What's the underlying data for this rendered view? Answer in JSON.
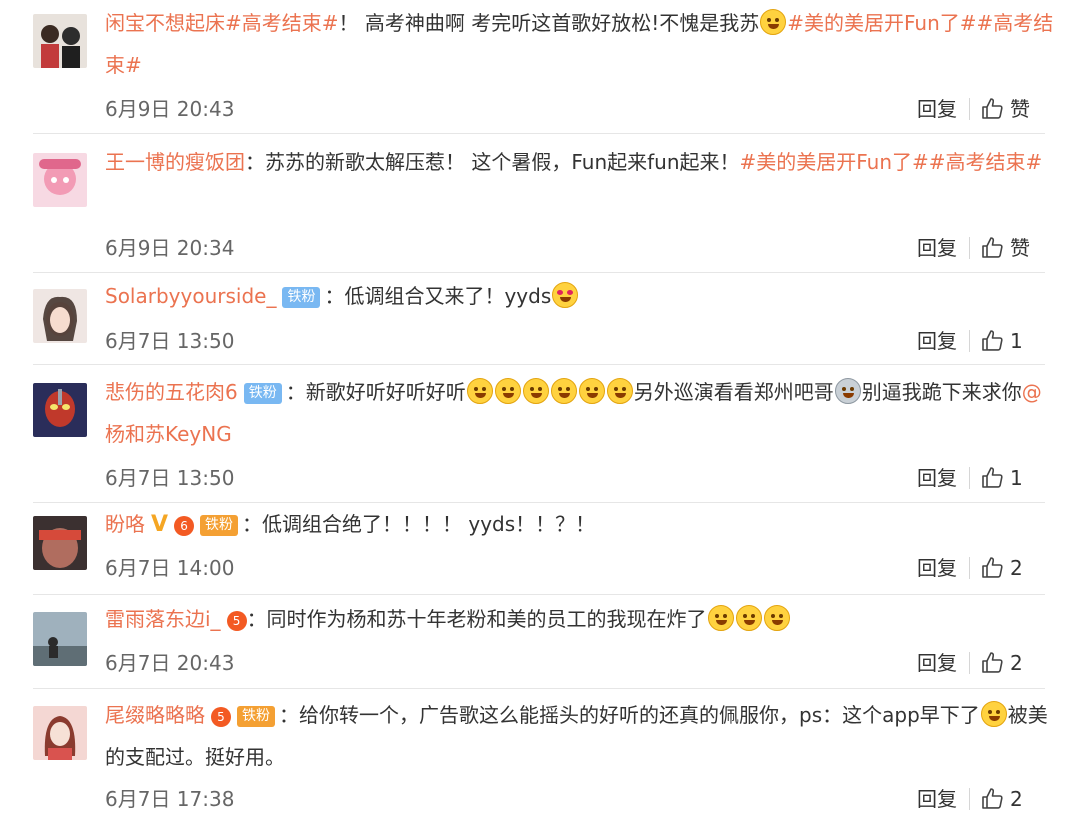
{
  "comments": [
    {
      "username": "闲宝不想起床",
      "text_a": "#高考结束#",
      "text_b": "！ 高考神曲啊 考完听这首歌好放松!不愧是我苏",
      "text_c": "#美的美居开Fun了##高考结束#",
      "time": "6月9日 20:43",
      "reply": "回复",
      "like": "赞"
    },
    {
      "username": "王一博的瘦饭团",
      "text_a": "：苏苏的新歌太解压惹！ 这个暑假，Fun起来fun起来！",
      "text_b": "#美的美居开Fun了##高考结束#",
      "time": "6月9日 20:34",
      "reply": "回复",
      "like": "赞"
    },
    {
      "username": "Solarbyyourside_",
      "badge": "铁粉",
      "text_a": "：低调组合又来了！yyds",
      "time": "6月7日 13:50",
      "reply": "回复",
      "like": "1"
    },
    {
      "username": "悲伤的五花肉6",
      "badge": "铁粉",
      "text_a": "：新歌好听好听好听",
      "text_b": "另外巡演看看郑州吧哥",
      "text_c": "别逼我跪下来求你",
      "mention": "@杨和苏KeyNG",
      "time": "6月7日 13:50",
      "reply": "回复",
      "like": "1"
    },
    {
      "username": "盼咯",
      "badge": "铁粉",
      "crown": "6",
      "text_a": "：低调组合绝了！！！！ yyds！！？！",
      "time": "6月7日 14:00",
      "reply": "回复",
      "like": "2"
    },
    {
      "username": "雷雨落东边i_",
      "crown": "5",
      "text_a": "：同时作为杨和苏十年老粉和美的员工的我现在炸了",
      "time": "6月7日 20:43",
      "reply": "回复",
      "like": "2"
    },
    {
      "username": "尾缀略略略",
      "badge": "铁粉",
      "crown": "5",
      "text_a": "：给你转一个，广告歌这么能摇头的好听的还真的佩服你，ps：这个app早下了",
      "text_b": "被美的支配过。挺好用。",
      "time": "6月7日 17:38",
      "reply": "回复",
      "like": "2"
    }
  ],
  "icons": {
    "like": "thumbs-up-icon",
    "emoji": "smiley-emoji-icon",
    "verified": "verified-v-icon",
    "fan_crown": "fan-crown-icon"
  },
  "colors": {
    "username": "#eb7350",
    "link": "#eb7350",
    "text": "#333333",
    "time": "#666666",
    "badge_blue": "#79b8f2",
    "badge_orange": "#f4a033",
    "divider": "#e6e6e6"
  }
}
